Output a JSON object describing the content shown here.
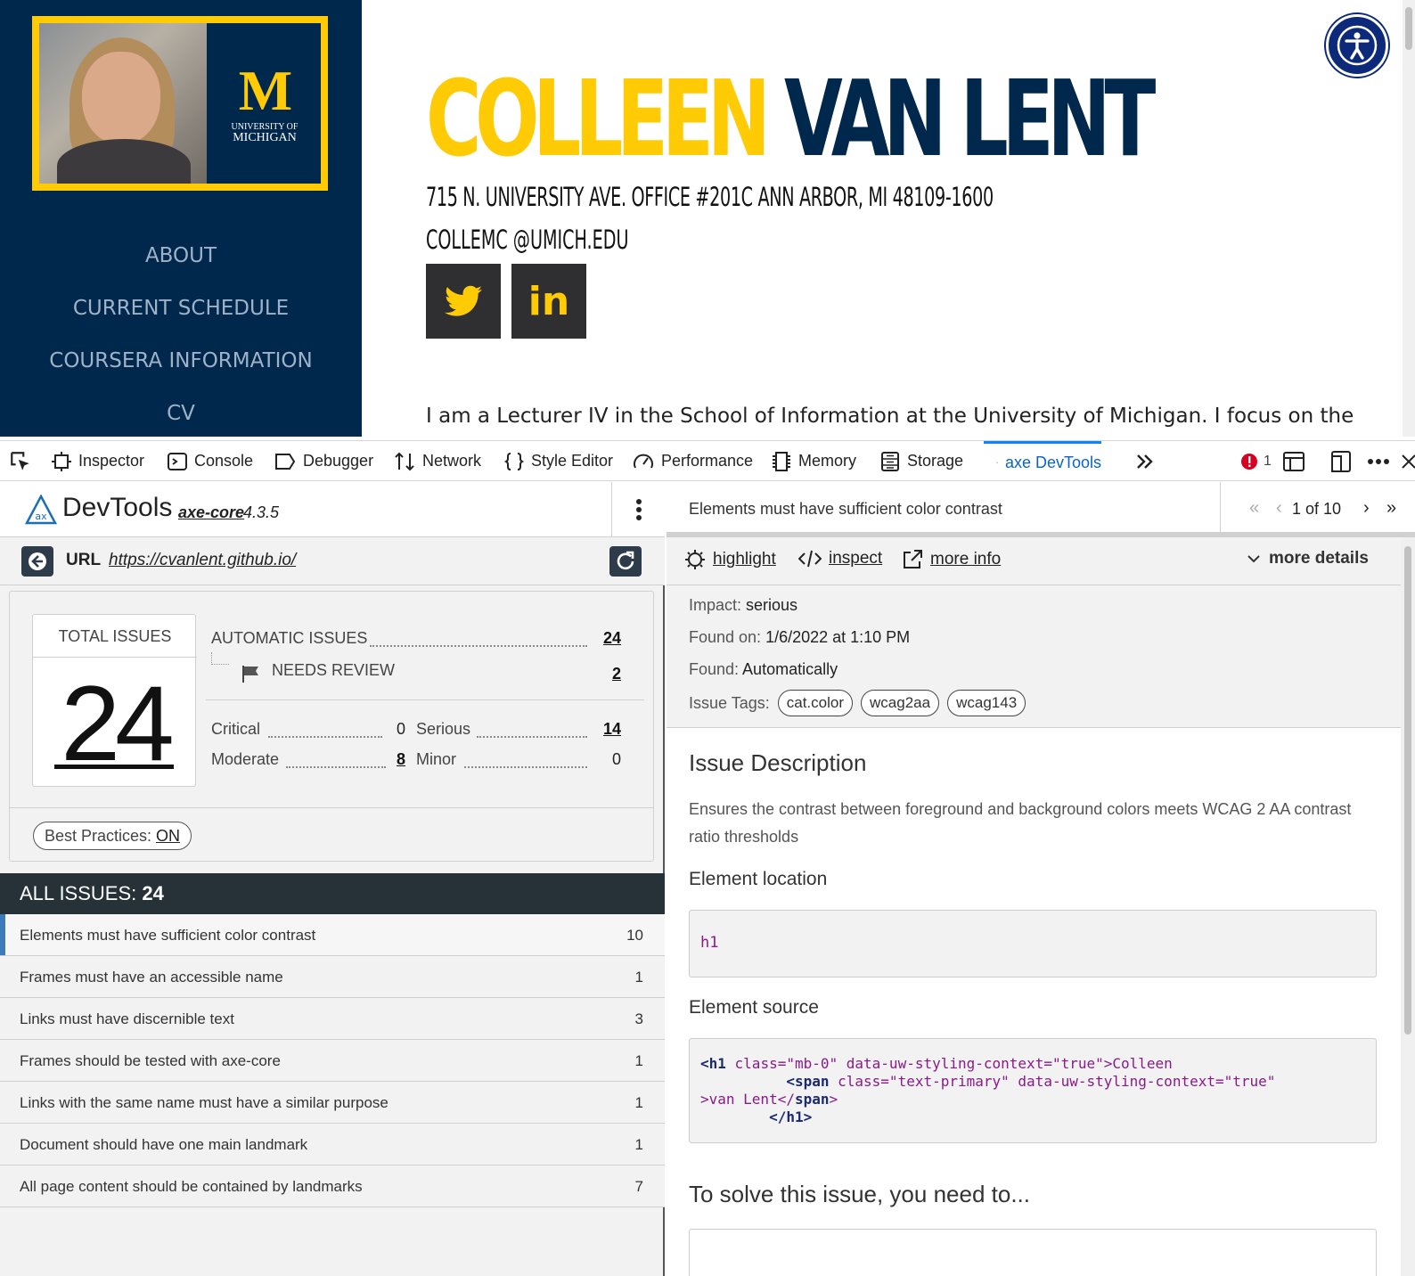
{
  "site": {
    "logo": {
      "university_line1": "UNIVERSITY OF",
      "university_line2": "MICHIGAN",
      "letter": "M"
    },
    "nav": [
      "ABOUT",
      "CURRENT SCHEDULE",
      "COURSERA INFORMATION",
      "CV"
    ],
    "title_first": "COLLEEN",
    "title_last": "VAN LENT",
    "address": "715 N. UNIVERSITY AVE. OFFICE #201C ANN ARBOR, MI 48109-1600",
    "email": "COLLEMC @UMICH.EDU",
    "social": {
      "twitter_icon": "twitter-bird-icon",
      "linkedin_text": "in"
    },
    "bio": "I am a Lecturer IV in the School of Information at the University of Michigan. I focus on the",
    "colors": {
      "maize": "#ffcb05",
      "blue": "#00274c"
    }
  },
  "devtools": {
    "tabs": [
      "Inspector",
      "Console",
      "Debugger",
      "Network",
      "Style Editor",
      "Performance",
      "Memory",
      "Storage",
      "axe DevTools"
    ],
    "active_tab": "axe DevTools",
    "error_count": "1"
  },
  "axe": {
    "brand": "DevTools",
    "core_link": "axe-core",
    "core_version": "4.3.5",
    "url_label": "URL",
    "url": "https://cvanlent.github.io/",
    "summary": {
      "total_label": "TOTAL ISSUES",
      "total": "24",
      "automatic_label": "AUTOMATIC ISSUES",
      "automatic": "24",
      "review_label": "NEEDS REVIEW",
      "review": "2",
      "critical_label": "Critical",
      "critical": "0",
      "serious_label": "Serious",
      "serious": "14",
      "moderate_label": "Moderate",
      "moderate": "8",
      "minor_label": "Minor",
      "minor": "0",
      "best_practices_label": "Best Practices: ",
      "best_practices_value": "ON"
    },
    "all_issues_label": "ALL ISSUES: ",
    "all_issues_count": "24",
    "issues": [
      {
        "label": "Elements must have sufficient color contrast",
        "count": "10"
      },
      {
        "label": "Frames must have an accessible name",
        "count": "1"
      },
      {
        "label": "Links must have discernible text",
        "count": "3"
      },
      {
        "label": "Frames should be tested with axe-core",
        "count": "1"
      },
      {
        "label": "Links with the same name must have a similar purpose",
        "count": "1"
      },
      {
        "label": "Document should have one main landmark",
        "count": "1"
      },
      {
        "label": "All page content should be contained by landmarks",
        "count": "7"
      }
    ]
  },
  "detail": {
    "title": "Elements must have sufficient color contrast",
    "pager": "1 of 10",
    "actions": {
      "highlight": "highlight",
      "inspect": "inspect",
      "more_info": "more info",
      "more_details": "more details"
    },
    "impact_label": "Impact: ",
    "impact": "serious",
    "found_on_label": "Found on: ",
    "found_on": "1/6/2022 at 1:10 PM",
    "found_label": "Found: ",
    "found": "Automatically",
    "tags_label": "Issue Tags:",
    "tags": [
      "cat.color",
      "wcag2aa",
      "wcag143"
    ],
    "description_heading": "Issue Description",
    "description": "Ensures the contrast between foreground and background colors meets WCAG 2 AA contrast ratio thresholds",
    "location_heading": "Element location",
    "location": "h1",
    "source_heading": "Element source",
    "source": {
      "l1_tag_open": "<h1",
      "l1_attrs": " class=\"mb-0\" data-uw-styling-context=\"true\">Colleen",
      "l2_indent": "          ",
      "l2_tag_open": "<span",
      "l2_attrs": " class=\"text-primary\" data-uw-styling-context=\"true\"",
      "l3_text": ">van Lent</",
      "l3_tag": "span",
      "l3_close": ">",
      "l4_indent": "        </",
      "l4_tag": "h1",
      "l4_close": ">"
    },
    "solve_heading": "To solve this issue, you need to..."
  }
}
